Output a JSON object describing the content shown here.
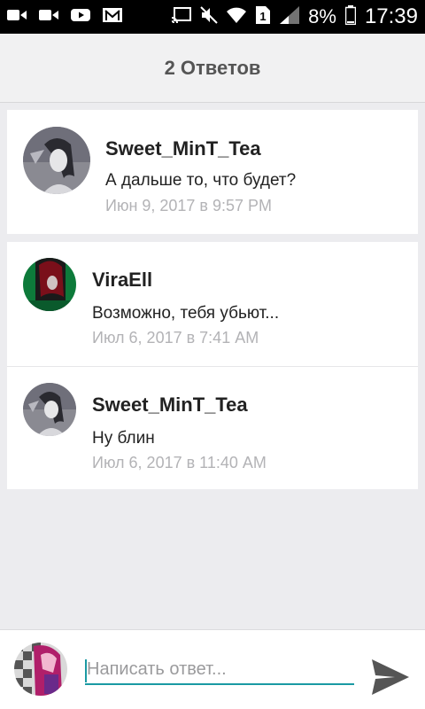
{
  "status_bar": {
    "battery": "8%",
    "time": "17:39",
    "sim_slot": "1",
    "icons": [
      "video-icon",
      "video-icon",
      "youtube-icon",
      "gmail-icon",
      "cast-icon",
      "mute-icon",
      "wifi-icon",
      "sim-icon",
      "signal-icon",
      "battery-icon"
    ]
  },
  "header": {
    "title": "2 Ответов"
  },
  "comments": [
    {
      "name": "Sweet_MinT_Tea",
      "text": "А дальше то, что будет?",
      "date": "Июн 9, 2017 в 9:57 PM"
    },
    {
      "name": "ViraEll",
      "text": "Возможно, тебя убьют...",
      "date": "Июл 6, 2017 в 7:41 AM"
    },
    {
      "name": "Sweet_MinT_Tea",
      "text": "Ну блин",
      "date": "Июл 6, 2017 в 11:40 AM"
    }
  ],
  "reply": {
    "placeholder": "Написать ответ...",
    "value": ""
  },
  "colors": {
    "accent": "#1b9aa3",
    "status_bar": "#000000",
    "background": "#ececef"
  }
}
